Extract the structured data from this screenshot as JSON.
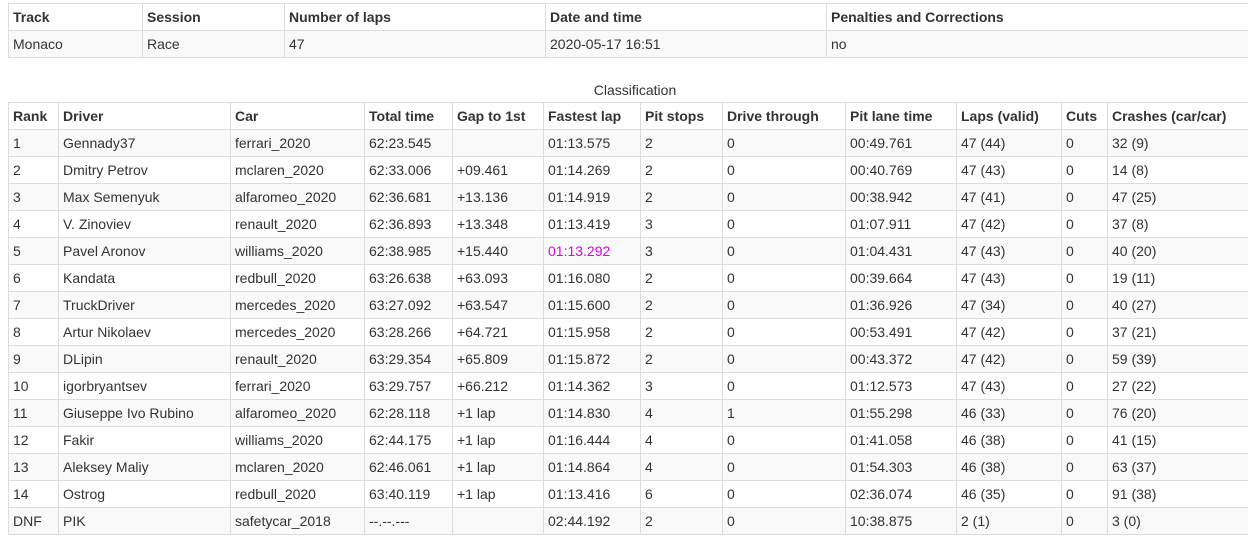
{
  "info": {
    "headers": [
      "Track",
      "Session",
      "Number of laps",
      "Date and time",
      "Penalties and Corrections"
    ],
    "values": [
      "Monaco",
      "Race",
      "47",
      "2020-05-17 16:51",
      "no"
    ]
  },
  "classification": {
    "title": "Classification",
    "headers": [
      "Rank",
      "Driver",
      "Car",
      "Total time",
      "Gap to 1st",
      "Fastest lap",
      "Pit stops",
      "Drive through",
      "Pit lane time",
      "Laps (valid)",
      "Cuts",
      "Crashes (car/car)"
    ],
    "best_lap_color": "#e000e0",
    "rows": [
      [
        "1",
        "Gennady37",
        "ferrari_2020",
        "62:23.545",
        "",
        "01:13.575",
        "2",
        "0",
        "00:49.761",
        "47 (44)",
        "0",
        "32 (9)"
      ],
      [
        "2",
        "Dmitry Petrov",
        "mclaren_2020",
        "62:33.006",
        "+09.461",
        "01:14.269",
        "2",
        "0",
        "00:40.769",
        "47 (43)",
        "0",
        "14 (8)"
      ],
      [
        "3",
        "Max Semenyuk",
        "alfaromeo_2020",
        "62:36.681",
        "+13.136",
        "01:14.919",
        "2",
        "0",
        "00:38.942",
        "47 (41)",
        "0",
        "47 (25)"
      ],
      [
        "4",
        "V. Zinoviev",
        "renault_2020",
        "62:36.893",
        "+13.348",
        "01:13.419",
        "3",
        "0",
        "01:07.911",
        "47 (42)",
        "0",
        "37 (8)"
      ],
      [
        "5",
        "Pavel Aronov",
        "williams_2020",
        "62:38.985",
        "+15.440",
        "01:13.292",
        "3",
        "0",
        "01:04.431",
        "47 (43)",
        "0",
        "40 (20)"
      ],
      [
        "6",
        "Kandata",
        "redbull_2020",
        "63:26.638",
        "+63.093",
        "01:16.080",
        "2",
        "0",
        "00:39.664",
        "47 (43)",
        "0",
        "19 (11)"
      ],
      [
        "7",
        "TruckDriver",
        "mercedes_2020",
        "63:27.092",
        "+63.547",
        "01:15.600",
        "2",
        "0",
        "01:36.926",
        "47 (34)",
        "0",
        "40 (27)"
      ],
      [
        "8",
        "Artur Nikolaev",
        "mercedes_2020",
        "63:28.266",
        "+64.721",
        "01:15.958",
        "2",
        "0",
        "00:53.491",
        "47 (42)",
        "0",
        "37 (21)"
      ],
      [
        "9",
        "DLipin",
        "renault_2020",
        "63:29.354",
        "+65.809",
        "01:15.872",
        "2",
        "0",
        "00:43.372",
        "47 (42)",
        "0",
        "59 (39)"
      ],
      [
        "10",
        "igorbryantsev",
        "ferrari_2020",
        "63:29.757",
        "+66.212",
        "01:14.362",
        "3",
        "0",
        "01:12.573",
        "47 (43)",
        "0",
        "27 (22)"
      ],
      [
        "11",
        "Giuseppe Ivo Rubino",
        "alfaromeo_2020",
        "62:28.118",
        "+1 lap",
        "01:14.830",
        "4",
        "1",
        "01:55.298",
        "46 (33)",
        "0",
        "76 (20)"
      ],
      [
        "12",
        "Fakir",
        "williams_2020",
        "62:44.175",
        "+1 lap",
        "01:16.444",
        "4",
        "0",
        "01:41.058",
        "46 (38)",
        "0",
        "41 (15)"
      ],
      [
        "13",
        "Aleksey Maliy",
        "mclaren_2020",
        "62:46.061",
        "+1 lap",
        "01:14.864",
        "4",
        "0",
        "01:54.303",
        "46 (38)",
        "0",
        "63 (37)"
      ],
      [
        "14",
        "Ostrog",
        "redbull_2020",
        "63:40.119",
        "+1 lap",
        "01:13.416",
        "6",
        "0",
        "02:36.074",
        "46 (35)",
        "0",
        "91 (38)"
      ],
      [
        "DNF",
        "PIK",
        "safetycar_2018",
        "--.--.---",
        "",
        "02:44.192",
        "2",
        "0",
        "10:38.875",
        "2 (1)",
        "0",
        "3 (0)"
      ]
    ],
    "best_lap_row": 4
  }
}
